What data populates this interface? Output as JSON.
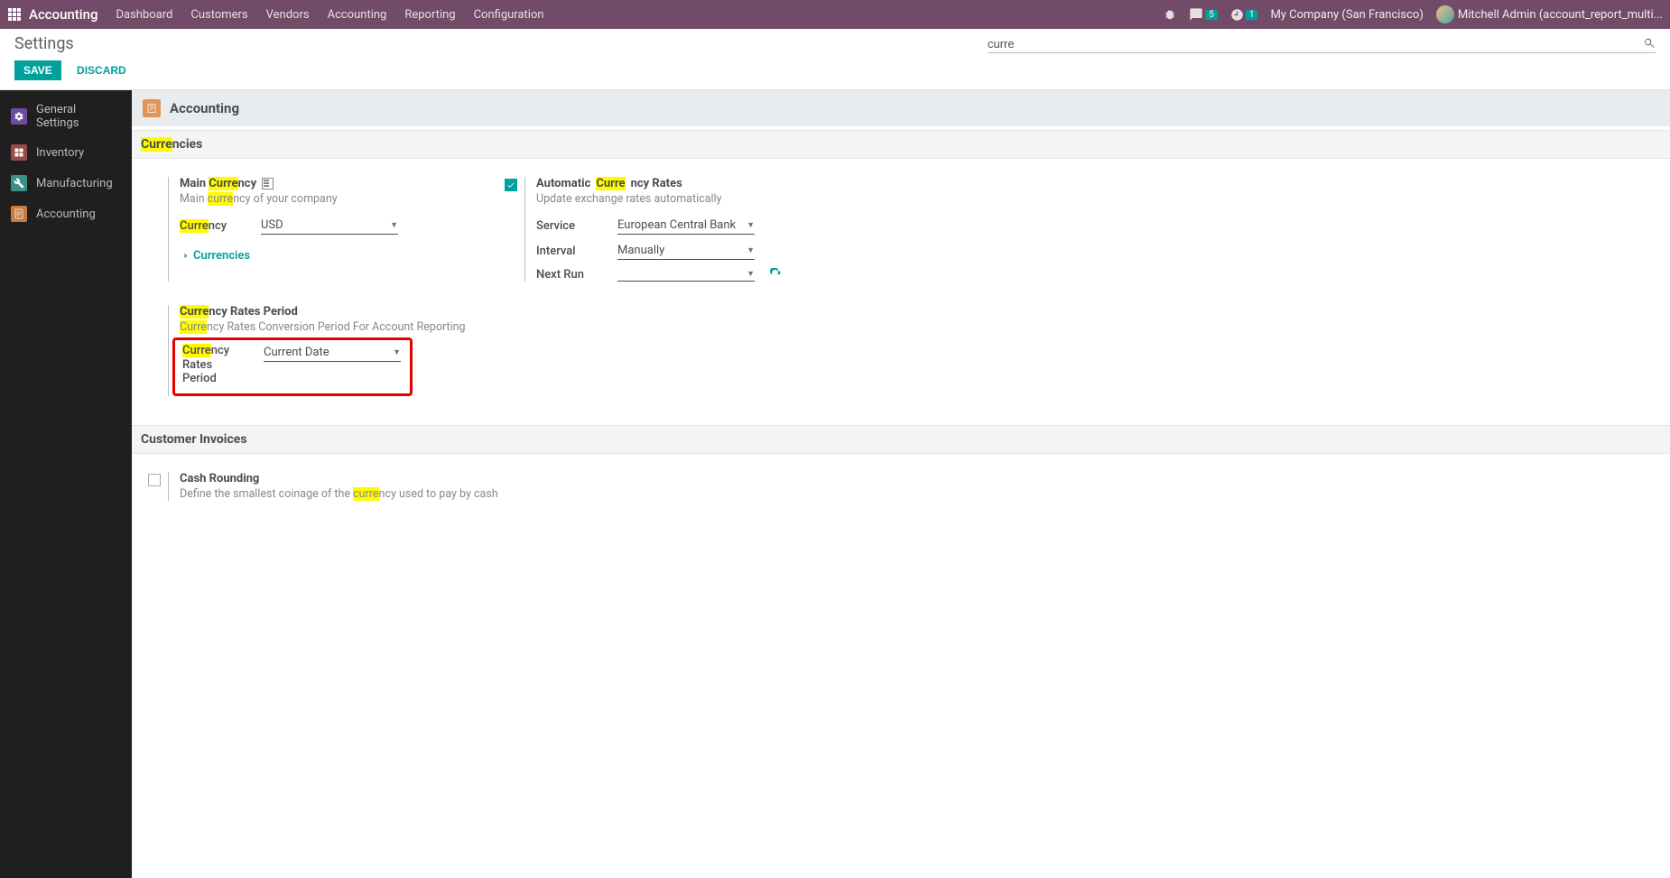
{
  "navbar": {
    "brand": "Accounting",
    "menu": [
      "Dashboard",
      "Customers",
      "Vendors",
      "Accounting",
      "Reporting",
      "Configuration"
    ],
    "msgBadge": "5",
    "clockBadge": "1",
    "company": "My Company (San Francisco)",
    "user": "Mitchell Admin (account_report_multi..."
  },
  "cp": {
    "title": "Settings",
    "search": "curre",
    "save": "SAVE",
    "discard": "DISCARD"
  },
  "sidebar": {
    "items": [
      {
        "label": "General Settings"
      },
      {
        "label": "Inventory"
      },
      {
        "label": "Manufacturing"
      },
      {
        "label": "Accounting"
      }
    ]
  },
  "app": {
    "title": "Accounting"
  },
  "sec1": {
    "title_pre": "Curre",
    "title_post": "ncies"
  },
  "mainCurr": {
    "t1": "Main ",
    "t2": "Curre",
    "t3": "ncy",
    "d1": "Main ",
    "d2": "curre",
    "d3": "ncy of your company",
    "fl1a": "Curre",
    "fl1b": "ncy",
    "value": "USD",
    "link": "Currencies"
  },
  "autoRates": {
    "t1": "Automatic ",
    "t2": "Curre",
    "t3": "ncy Rates",
    "desc": "Update exchange rates automatically",
    "service_lbl": "Service",
    "service_val": "European Central Bank",
    "interval_lbl": "Interval",
    "interval_val": "Manually",
    "nextrun_lbl": "Next Run",
    "nextrun_val": ""
  },
  "ratesPeriod": {
    "t1": "Curre",
    "t2": "ncy Rates Period",
    "d1": "Curre",
    "d2": "ncy Rates Conversion Period For Account Reporting",
    "fl1": "Curre",
    "fl2": "ncy",
    "fl3": "Rates Period",
    "value": "Current Date"
  },
  "sec2": {
    "title": "Customer Invoices"
  },
  "cashRound": {
    "title": "Cash Rounding",
    "d1": "Define the smallest coinage of the ",
    "d2": "curre",
    "d3": "ncy used to pay by cash"
  }
}
